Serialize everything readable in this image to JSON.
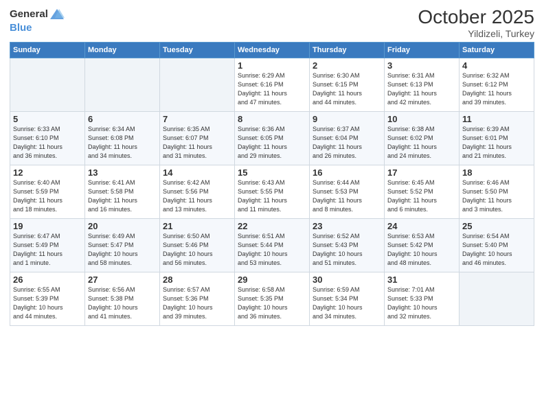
{
  "header": {
    "logo_general": "General",
    "logo_blue": "Blue",
    "month": "October 2025",
    "location": "Yildizeli, Turkey"
  },
  "days_of_week": [
    "Sunday",
    "Monday",
    "Tuesday",
    "Wednesday",
    "Thursday",
    "Friday",
    "Saturday"
  ],
  "weeks": [
    [
      {
        "num": "",
        "info": ""
      },
      {
        "num": "",
        "info": ""
      },
      {
        "num": "",
        "info": ""
      },
      {
        "num": "1",
        "info": "Sunrise: 6:29 AM\nSunset: 6:16 PM\nDaylight: 11 hours\nand 47 minutes."
      },
      {
        "num": "2",
        "info": "Sunrise: 6:30 AM\nSunset: 6:15 PM\nDaylight: 11 hours\nand 44 minutes."
      },
      {
        "num": "3",
        "info": "Sunrise: 6:31 AM\nSunset: 6:13 PM\nDaylight: 11 hours\nand 42 minutes."
      },
      {
        "num": "4",
        "info": "Sunrise: 6:32 AM\nSunset: 6:12 PM\nDaylight: 11 hours\nand 39 minutes."
      }
    ],
    [
      {
        "num": "5",
        "info": "Sunrise: 6:33 AM\nSunset: 6:10 PM\nDaylight: 11 hours\nand 36 minutes."
      },
      {
        "num": "6",
        "info": "Sunrise: 6:34 AM\nSunset: 6:08 PM\nDaylight: 11 hours\nand 34 minutes."
      },
      {
        "num": "7",
        "info": "Sunrise: 6:35 AM\nSunset: 6:07 PM\nDaylight: 11 hours\nand 31 minutes."
      },
      {
        "num": "8",
        "info": "Sunrise: 6:36 AM\nSunset: 6:05 PM\nDaylight: 11 hours\nand 29 minutes."
      },
      {
        "num": "9",
        "info": "Sunrise: 6:37 AM\nSunset: 6:04 PM\nDaylight: 11 hours\nand 26 minutes."
      },
      {
        "num": "10",
        "info": "Sunrise: 6:38 AM\nSunset: 6:02 PM\nDaylight: 11 hours\nand 24 minutes."
      },
      {
        "num": "11",
        "info": "Sunrise: 6:39 AM\nSunset: 6:01 PM\nDaylight: 11 hours\nand 21 minutes."
      }
    ],
    [
      {
        "num": "12",
        "info": "Sunrise: 6:40 AM\nSunset: 5:59 PM\nDaylight: 11 hours\nand 18 minutes."
      },
      {
        "num": "13",
        "info": "Sunrise: 6:41 AM\nSunset: 5:58 PM\nDaylight: 11 hours\nand 16 minutes."
      },
      {
        "num": "14",
        "info": "Sunrise: 6:42 AM\nSunset: 5:56 PM\nDaylight: 11 hours\nand 13 minutes."
      },
      {
        "num": "15",
        "info": "Sunrise: 6:43 AM\nSunset: 5:55 PM\nDaylight: 11 hours\nand 11 minutes."
      },
      {
        "num": "16",
        "info": "Sunrise: 6:44 AM\nSunset: 5:53 PM\nDaylight: 11 hours\nand 8 minutes."
      },
      {
        "num": "17",
        "info": "Sunrise: 6:45 AM\nSunset: 5:52 PM\nDaylight: 11 hours\nand 6 minutes."
      },
      {
        "num": "18",
        "info": "Sunrise: 6:46 AM\nSunset: 5:50 PM\nDaylight: 11 hours\nand 3 minutes."
      }
    ],
    [
      {
        "num": "19",
        "info": "Sunrise: 6:47 AM\nSunset: 5:49 PM\nDaylight: 11 hours\nand 1 minute."
      },
      {
        "num": "20",
        "info": "Sunrise: 6:49 AM\nSunset: 5:47 PM\nDaylight: 10 hours\nand 58 minutes."
      },
      {
        "num": "21",
        "info": "Sunrise: 6:50 AM\nSunset: 5:46 PM\nDaylight: 10 hours\nand 56 minutes."
      },
      {
        "num": "22",
        "info": "Sunrise: 6:51 AM\nSunset: 5:44 PM\nDaylight: 10 hours\nand 53 minutes."
      },
      {
        "num": "23",
        "info": "Sunrise: 6:52 AM\nSunset: 5:43 PM\nDaylight: 10 hours\nand 51 minutes."
      },
      {
        "num": "24",
        "info": "Sunrise: 6:53 AM\nSunset: 5:42 PM\nDaylight: 10 hours\nand 48 minutes."
      },
      {
        "num": "25",
        "info": "Sunrise: 6:54 AM\nSunset: 5:40 PM\nDaylight: 10 hours\nand 46 minutes."
      }
    ],
    [
      {
        "num": "26",
        "info": "Sunrise: 6:55 AM\nSunset: 5:39 PM\nDaylight: 10 hours\nand 44 minutes."
      },
      {
        "num": "27",
        "info": "Sunrise: 6:56 AM\nSunset: 5:38 PM\nDaylight: 10 hours\nand 41 minutes."
      },
      {
        "num": "28",
        "info": "Sunrise: 6:57 AM\nSunset: 5:36 PM\nDaylight: 10 hours\nand 39 minutes."
      },
      {
        "num": "29",
        "info": "Sunrise: 6:58 AM\nSunset: 5:35 PM\nDaylight: 10 hours\nand 36 minutes."
      },
      {
        "num": "30",
        "info": "Sunrise: 6:59 AM\nSunset: 5:34 PM\nDaylight: 10 hours\nand 34 minutes."
      },
      {
        "num": "31",
        "info": "Sunrise: 7:01 AM\nSunset: 5:33 PM\nDaylight: 10 hours\nand 32 minutes."
      },
      {
        "num": "",
        "info": ""
      }
    ]
  ]
}
